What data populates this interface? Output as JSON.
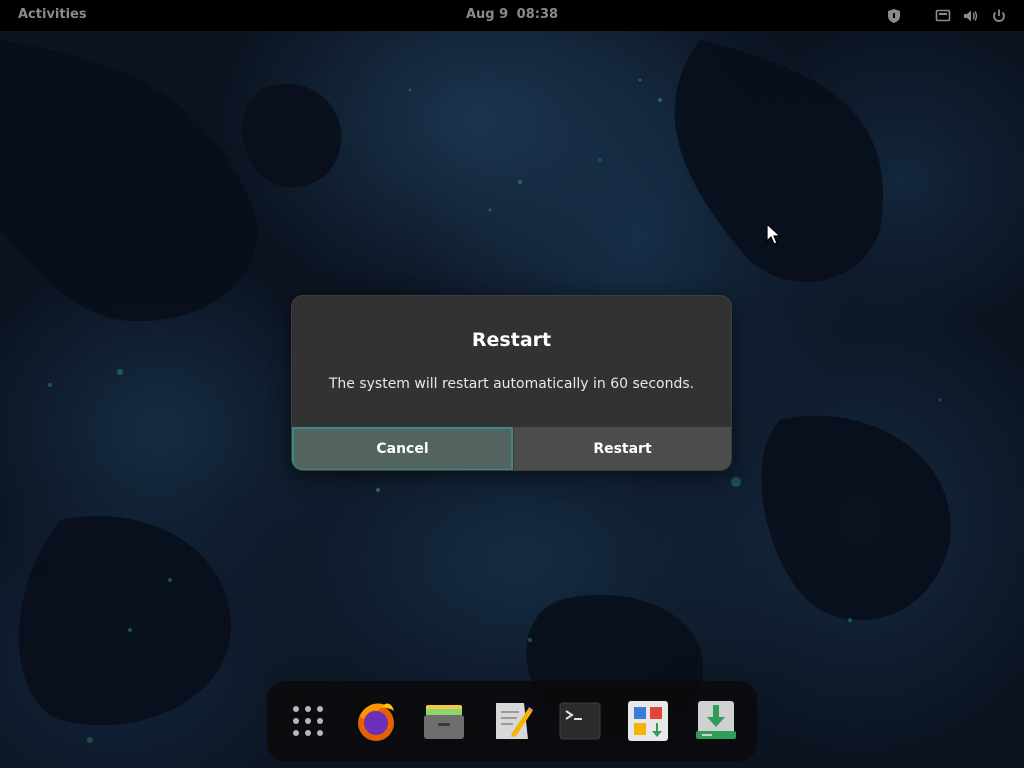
{
  "topbar": {
    "activities_label": "Activities",
    "date": "Aug 9",
    "time": "08:38",
    "tray_icons": [
      "shield-icon",
      "screen-icon",
      "volume-icon",
      "power-icon"
    ]
  },
  "dialog": {
    "title": "Restart",
    "message": "The system will restart automatically in 60 seconds.",
    "cancel_label": "Cancel",
    "restart_label": "Restart"
  },
  "dock": {
    "items": [
      "app-grid-icon",
      "firefox-icon",
      "files-icon",
      "text-editor-icon",
      "terminal-icon",
      "software-center-icon",
      "installer-icon"
    ]
  },
  "colors": {
    "dialog_bg": "#323232",
    "focus_accent": "#3b8b84",
    "topbar_bg": "#000000"
  }
}
